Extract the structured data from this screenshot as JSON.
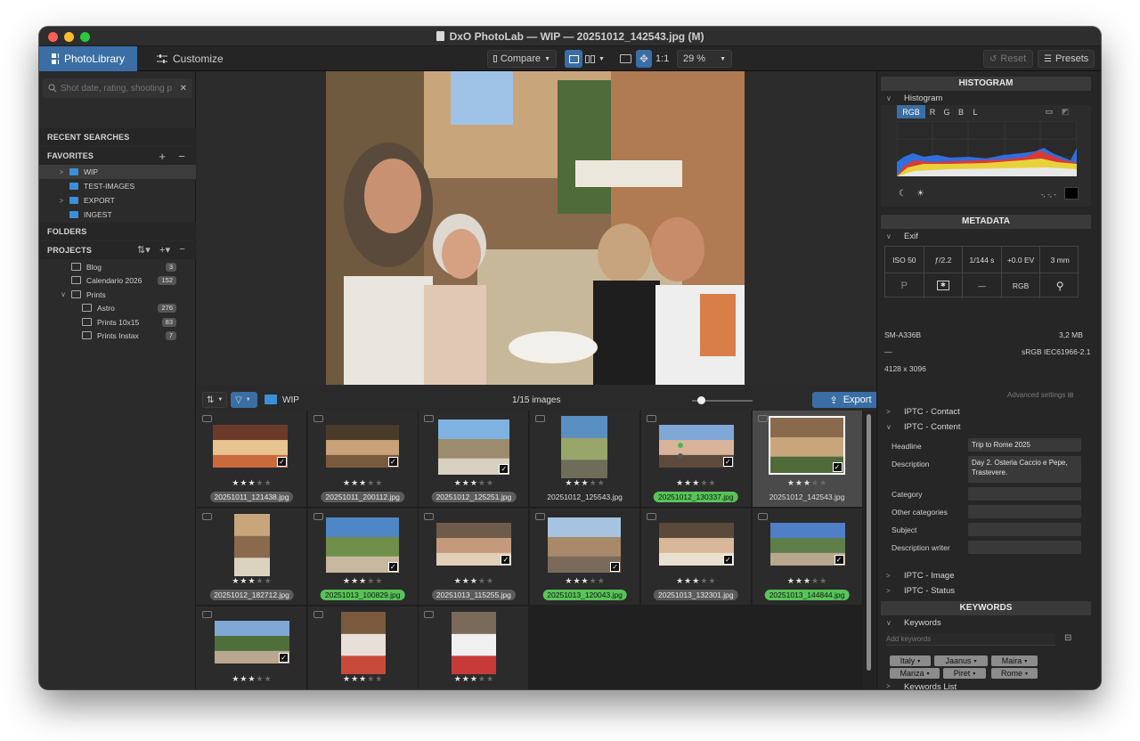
{
  "window": {
    "title": "DxO PhotoLab — WIP — 20251012_142543.jpg (M)"
  },
  "toolbar": {
    "tab_library": "PhotoLibrary",
    "tab_customize": "Customize",
    "compare": "Compare",
    "one_to_one": "1:1",
    "zoom": "29 %",
    "reset": "Reset",
    "presets": "Presets"
  },
  "sidebar": {
    "search_placeholder": "Shot date, rating, shooting p",
    "recent_searches": "RECENT SEARCHES",
    "favorites": "FAVORITES",
    "favorite_items": [
      {
        "label": "WIP",
        "expandable": true
      },
      {
        "label": "TEST-IMAGES",
        "expandable": false
      },
      {
        "label": "EXPORT",
        "expandable": true
      },
      {
        "label": "INGEST",
        "expandable": false
      }
    ],
    "folders": "FOLDERS",
    "projects": "PROJECTS",
    "project_items": [
      {
        "label": "Blog",
        "count": "3"
      },
      {
        "label": "Calendario 2026",
        "count": "152"
      },
      {
        "label": "Prints",
        "count": ""
      },
      {
        "label": "Astro",
        "count": "276"
      },
      {
        "label": "Prints 10x15",
        "count": "83"
      },
      {
        "label": "Prints Instax",
        "count": "7"
      }
    ]
  },
  "filmstrip": {
    "folder": "WIP",
    "count": "1/15 images",
    "export": "Export",
    "thumbs": [
      {
        "name": "20251011_121438.jpg",
        "tag": "grey",
        "rating": 3
      },
      {
        "name": "20251011_200112.jpg",
        "tag": "grey",
        "rating": 3
      },
      {
        "name": "20251012_125251.jpg",
        "tag": "grey",
        "rating": 3
      },
      {
        "name": "20251012_125543.jpg",
        "tag": "none",
        "rating": 3
      },
      {
        "name": "20251012_130337.jpg",
        "tag": "green",
        "rating": 3
      },
      {
        "name": "20251012_142543.jpg",
        "tag": "none",
        "rating": 3
      },
      {
        "name": "20251012_182712.jpg",
        "tag": "grey",
        "rating": 3
      },
      {
        "name": "20251013_100829.jpg",
        "tag": "green",
        "rating": 3
      },
      {
        "name": "20251013_115255.jpg",
        "tag": "grey",
        "rating": 3
      },
      {
        "name": "20251013_120043.jpg",
        "tag": "green",
        "rating": 3
      },
      {
        "name": "20251013_132301.jpg",
        "tag": "grey",
        "rating": 3
      },
      {
        "name": "20251013_144844.jpg",
        "tag": "green",
        "rating": 3
      },
      {
        "name": "",
        "tag": "none",
        "rating": 3
      },
      {
        "name": "",
        "tag": "none",
        "rating": 3
      },
      {
        "name": "",
        "tag": "none",
        "rating": 3
      }
    ]
  },
  "histogram": {
    "header": "HISTOGRAM",
    "sub": "Histogram",
    "channels": [
      "RGB",
      "R",
      "G",
      "B",
      "L"
    ],
    "readout": "-, -, -"
  },
  "metadata": {
    "header": "METADATA",
    "exif": "Exif",
    "row1": [
      "ISO 50",
      "ƒ/2.2",
      "1/144 s",
      "+0.0 EV",
      "3 mm"
    ],
    "row2": [
      "P",
      "",
      "—",
      "RGB",
      ""
    ],
    "camera": "SM-A336B",
    "filesize": "3,2 MB",
    "dash": "—",
    "colorspace": "sRGB IEC61966-2.1",
    "dimensions": "4128 x 3096",
    "advanced": "Advanced settings",
    "iptc_contact": "IPTC - Contact",
    "iptc_content": "IPTC - Content",
    "fields": [
      {
        "label": "Headline",
        "value": "Trip to Rome 2025"
      },
      {
        "label": "Description",
        "value": "Day 2. Osteria Caccio e Pepe, Trastevere."
      },
      {
        "label": "Category",
        "value": ""
      },
      {
        "label": "Other categories",
        "value": ""
      },
      {
        "label": "Subject",
        "value": ""
      },
      {
        "label": "Description writer",
        "value": ""
      }
    ],
    "iptc_image": "IPTC - Image",
    "iptc_status": "IPTC - Status"
  },
  "keywords": {
    "header": "KEYWORDS",
    "sub": "Keywords",
    "placeholder": "Add keywords",
    "tags": [
      "Italy",
      "Jaanus",
      "Maira",
      "Mariza",
      "Piret",
      "Rome"
    ],
    "list": "Keywords List"
  },
  "colors": {
    "accent": "#3a6ea5",
    "green_tag": "#59c35a",
    "folder": "#3b8fd6"
  }
}
